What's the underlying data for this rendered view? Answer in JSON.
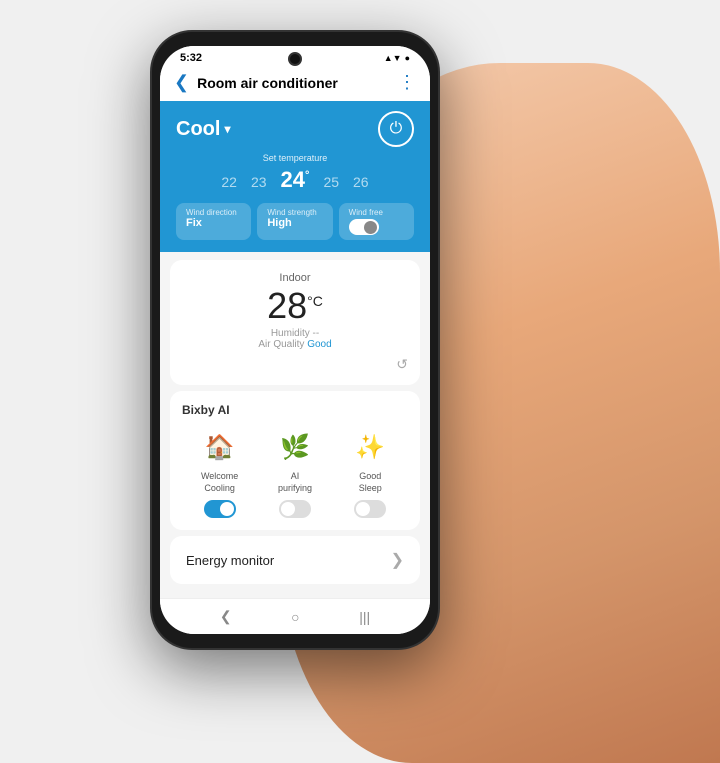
{
  "status_bar": {
    "time": "5:32",
    "signal": "▲▼",
    "battery": "●"
  },
  "nav": {
    "back_icon": "❮",
    "title": "Room air conditioner",
    "more_icon": "⋮"
  },
  "ac_header": {
    "mode": "Cool",
    "mode_arrow": "▾",
    "power_icon": "⏻",
    "set_temp_label": "Set temperature",
    "temperatures": [
      {
        "value": "22",
        "active": false
      },
      {
        "value": "23",
        "active": false
      },
      {
        "value": "24",
        "active": true
      },
      {
        "value": "25",
        "active": false
      },
      {
        "value": "26",
        "active": false
      }
    ],
    "temp_unit": "°",
    "controls": [
      {
        "label": "Wind direction",
        "value": "Fix"
      },
      {
        "label": "Wind strength",
        "value": "High"
      },
      {
        "label": "Wind free",
        "value": "",
        "is_toggle": true
      }
    ]
  },
  "indoor": {
    "label": "Indoor",
    "temperature": "28",
    "unit": "°C",
    "humidity": "Humidity --",
    "air_quality_label": "Air Quality",
    "air_quality_value": "Good",
    "refresh_icon": "↺"
  },
  "bixby": {
    "title": "Bixby AI",
    "items": [
      {
        "icon": "🏠",
        "label": "Welcome\nCooling",
        "toggle_on": true
      },
      {
        "icon": "🌿",
        "label": "AI\npurifying",
        "toggle_on": false
      },
      {
        "icon": "✨",
        "label": "Good\nSleep",
        "toggle_on": false
      }
    ]
  },
  "energy_monitor": {
    "label": "Energy monitor",
    "chevron": "❯"
  },
  "bottom_nav": {
    "back": "❮",
    "home": "○",
    "recent": "|||"
  },
  "colors": {
    "accent": "#2196d3",
    "good": "#2196d3"
  }
}
